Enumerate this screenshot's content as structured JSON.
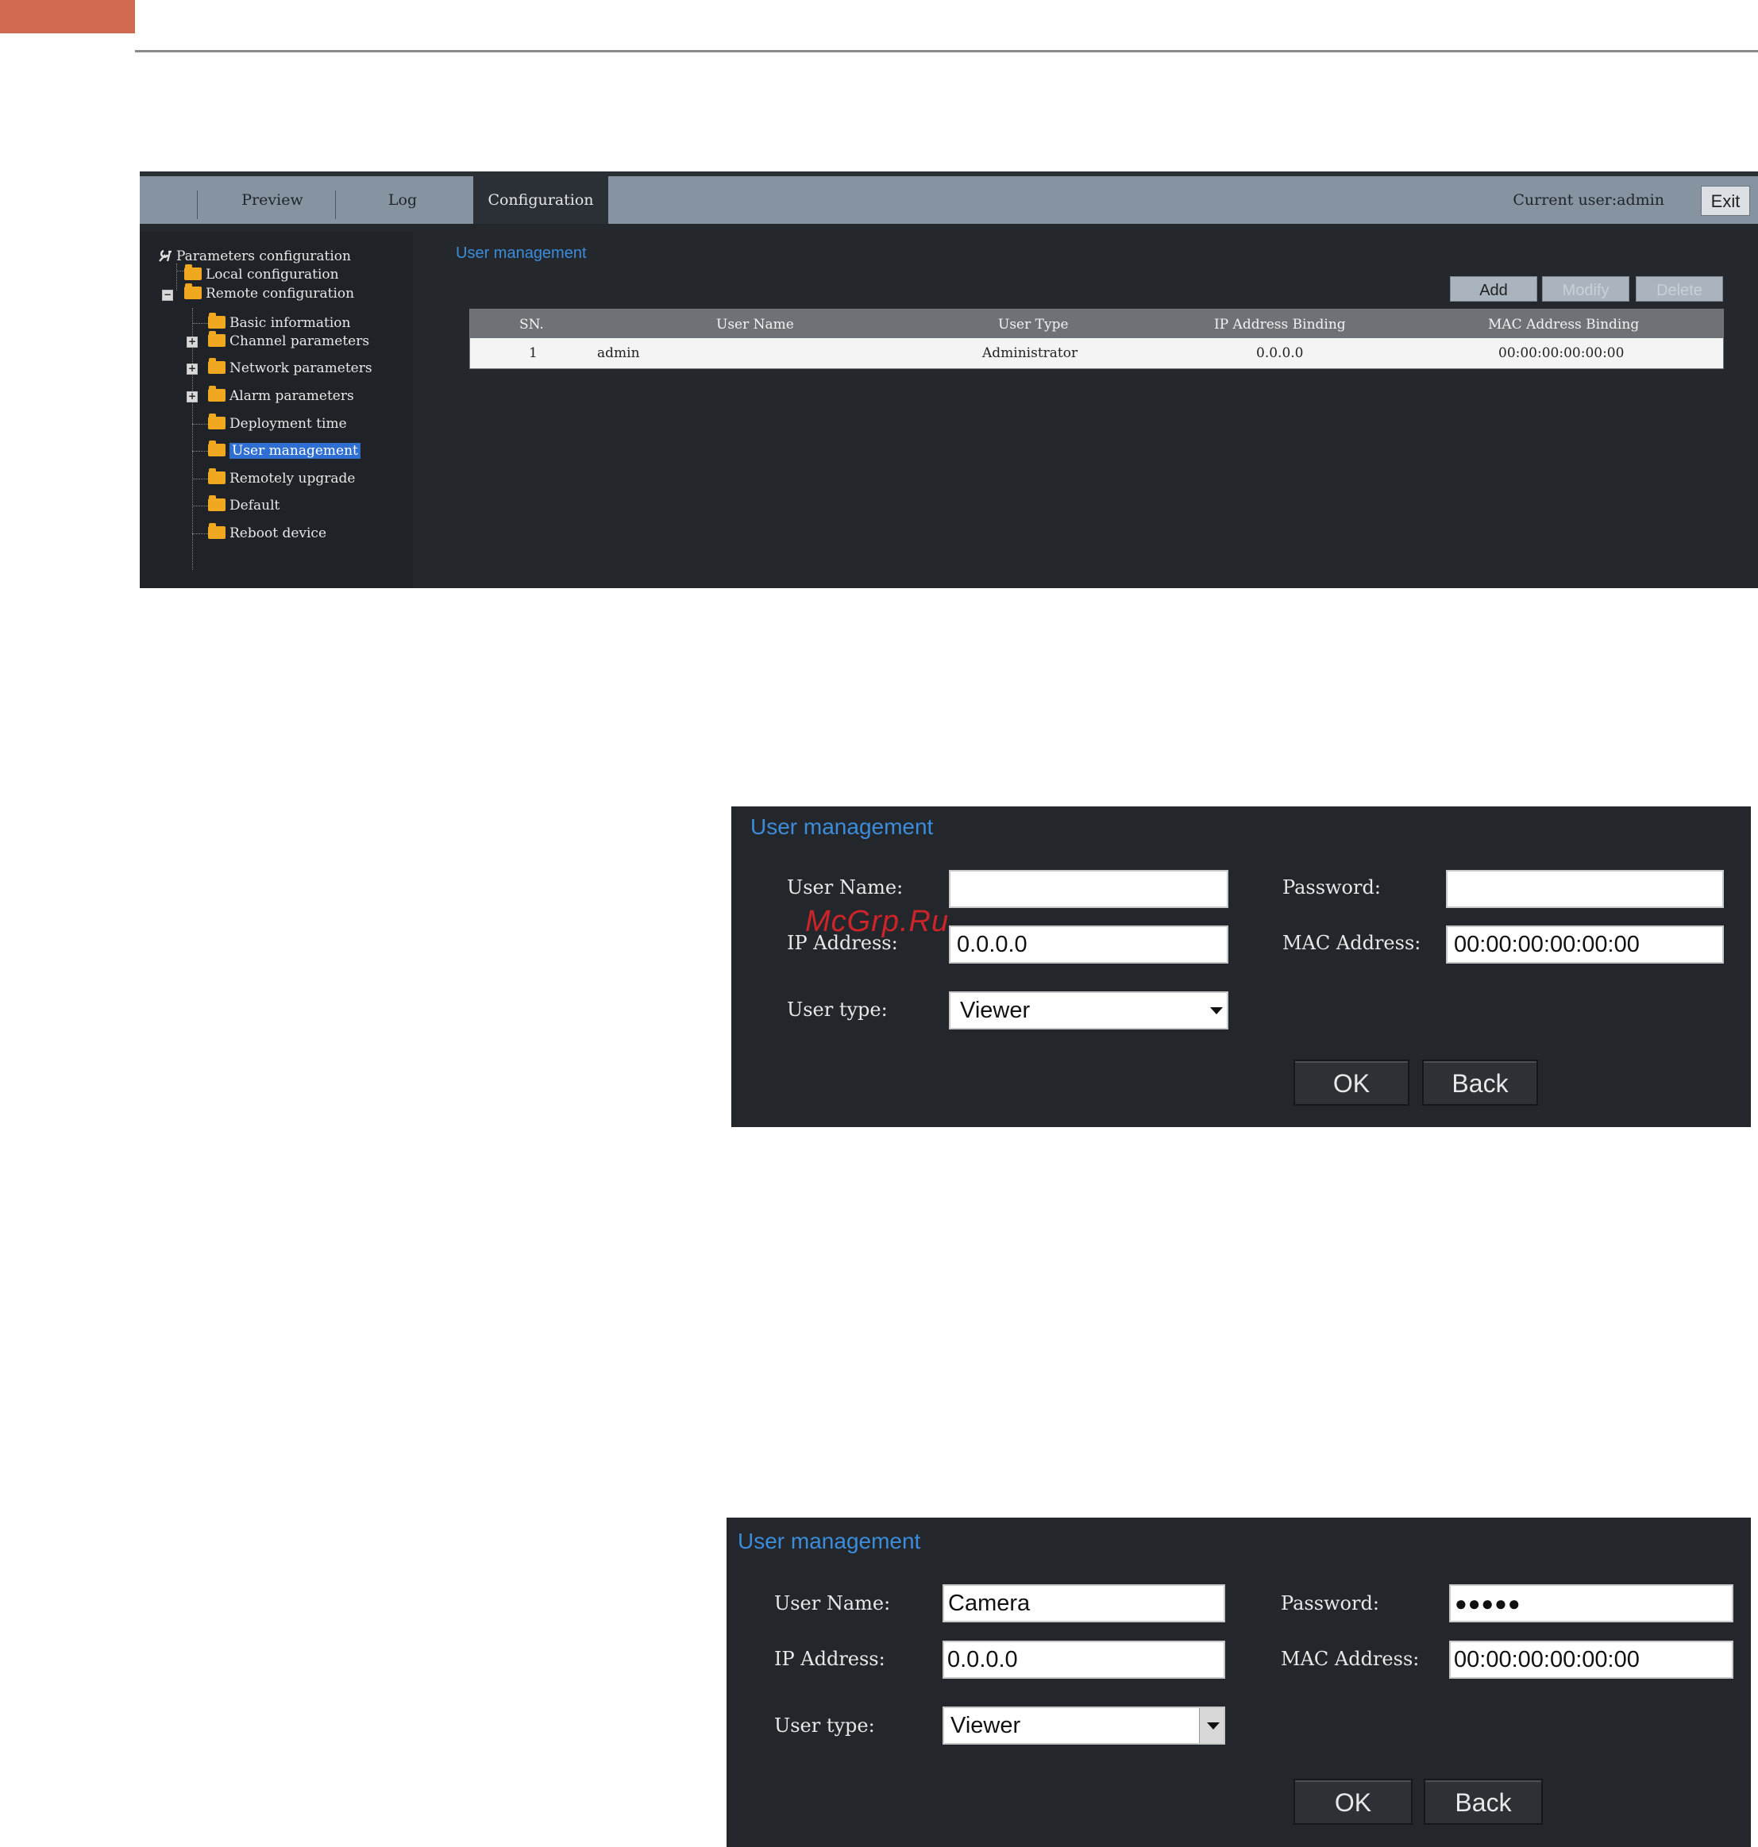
{
  "watermark": "McGrp.Ru",
  "app": {
    "tabs": [
      "Preview",
      "Log",
      "Configuration"
    ],
    "active_tab": "Configuration",
    "current_user": "Current user:admin",
    "exit_label": "Exit"
  },
  "tree": {
    "root": "Parameters configuration",
    "local": "Local configuration",
    "remote": "Remote configuration",
    "children": [
      "Basic information",
      "Channel parameters",
      "Network parameters",
      "Alarm parameters",
      "Deployment time",
      "User management",
      "Remotely upgrade",
      "Default",
      "Reboot device"
    ],
    "selected": "User management"
  },
  "panel": {
    "title": "User management",
    "buttons": {
      "add": "Add",
      "modify": "Modify",
      "delete": "Delete"
    },
    "columns": [
      "SN.",
      "User Name",
      "User Type",
      "IP Address Binding",
      "MAC Address Binding"
    ],
    "rows": [
      {
        "sn": "1",
        "user_name": "admin",
        "user_type": "Administrator",
        "ip": "0.0.0.0",
        "mac": "00:00:00:00:00:00"
      }
    ]
  },
  "dialog1": {
    "title": "User management",
    "user_name_label": "User Name:",
    "password_label": "Password:",
    "ip_label": "IP Address:",
    "mac_label": "MAC Address:",
    "user_type_label": "User type:",
    "user_name": "",
    "password": "",
    "ip": "0.0.0.0",
    "mac": "00:00:00:00:00:00",
    "user_type": "Viewer",
    "ok": "OK",
    "back": "Back"
  },
  "dialog2": {
    "title": "User management",
    "user_name_label": "User Name:",
    "password_label": "Password:",
    "ip_label": "IP Address:",
    "mac_label": "MAC Address:",
    "user_type_label": "User type:",
    "user_name": "Camera",
    "password": "●●●●●",
    "ip": "0.0.0.0",
    "mac": "00:00:00:00:00:00",
    "user_type": "Viewer",
    "ok": "OK",
    "back": "Back"
  },
  "colors": {
    "accent": "#cf6a50",
    "title_blue": "#3c8cdc",
    "selection": "#2f6fd1",
    "folder": "#f0a820"
  }
}
